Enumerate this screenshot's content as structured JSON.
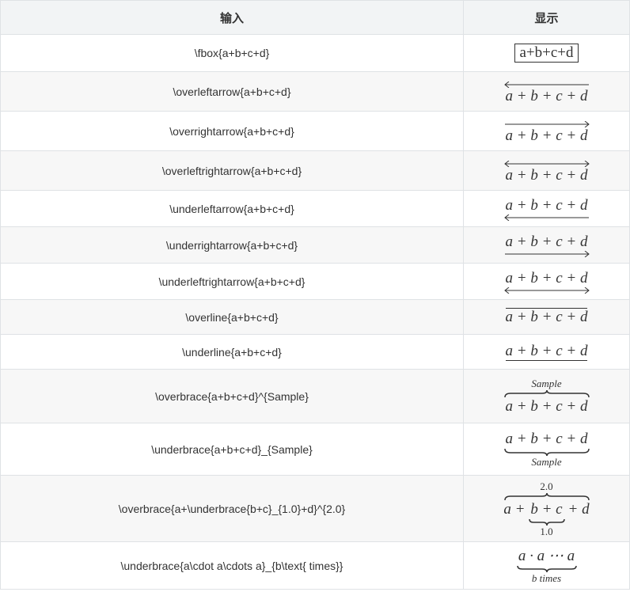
{
  "header": {
    "col_input": "输入",
    "col_display": "显示"
  },
  "rows": [
    {
      "input": "\\fbox{a+b+c+d}",
      "display": "a+b+c+d"
    },
    {
      "input": "\\overleftarrow{a+b+c+d}",
      "display": "a + b + c + d"
    },
    {
      "input": "\\overrightarrow{a+b+c+d}",
      "display": "a + b + c + d"
    },
    {
      "input": "\\overleftrightarrow{a+b+c+d}",
      "display": "a + b + c + d"
    },
    {
      "input": "\\underleftarrow{a+b+c+d}",
      "display": "a + b + c + d"
    },
    {
      "input": "\\underrightarrow{a+b+c+d}",
      "display": "a + b + c + d"
    },
    {
      "input": "\\underleftrightarrow{a+b+c+d}",
      "display": "a + b + c + d"
    },
    {
      "input": "\\overline{a+b+c+d}",
      "display": "a + b + c + d"
    },
    {
      "input": "\\underline{a+b+c+d}",
      "display": "a + b + c + d"
    },
    {
      "input": "\\overbrace{a+b+c+d}^{Sample}",
      "display": "a + b + c + d",
      "annotation": "Sample"
    },
    {
      "input": "\\underbrace{a+b+c+d}_{Sample}",
      "display": "a + b + c + d",
      "annotation": "Sample"
    },
    {
      "input": "\\overbrace{a+\\underbrace{b+c}_{1.0}+d}^{2.0}",
      "display_a": "a +",
      "display_bc": "b + c",
      "display_d": "+ d",
      "annotation_top": "2.0",
      "annotation_bottom": "1.0"
    },
    {
      "input": "\\underbrace{a\\cdot a\\cdots a}_{b\\text{ times}}",
      "display": "a · a ⋯ a",
      "annotation": "b times"
    }
  ]
}
